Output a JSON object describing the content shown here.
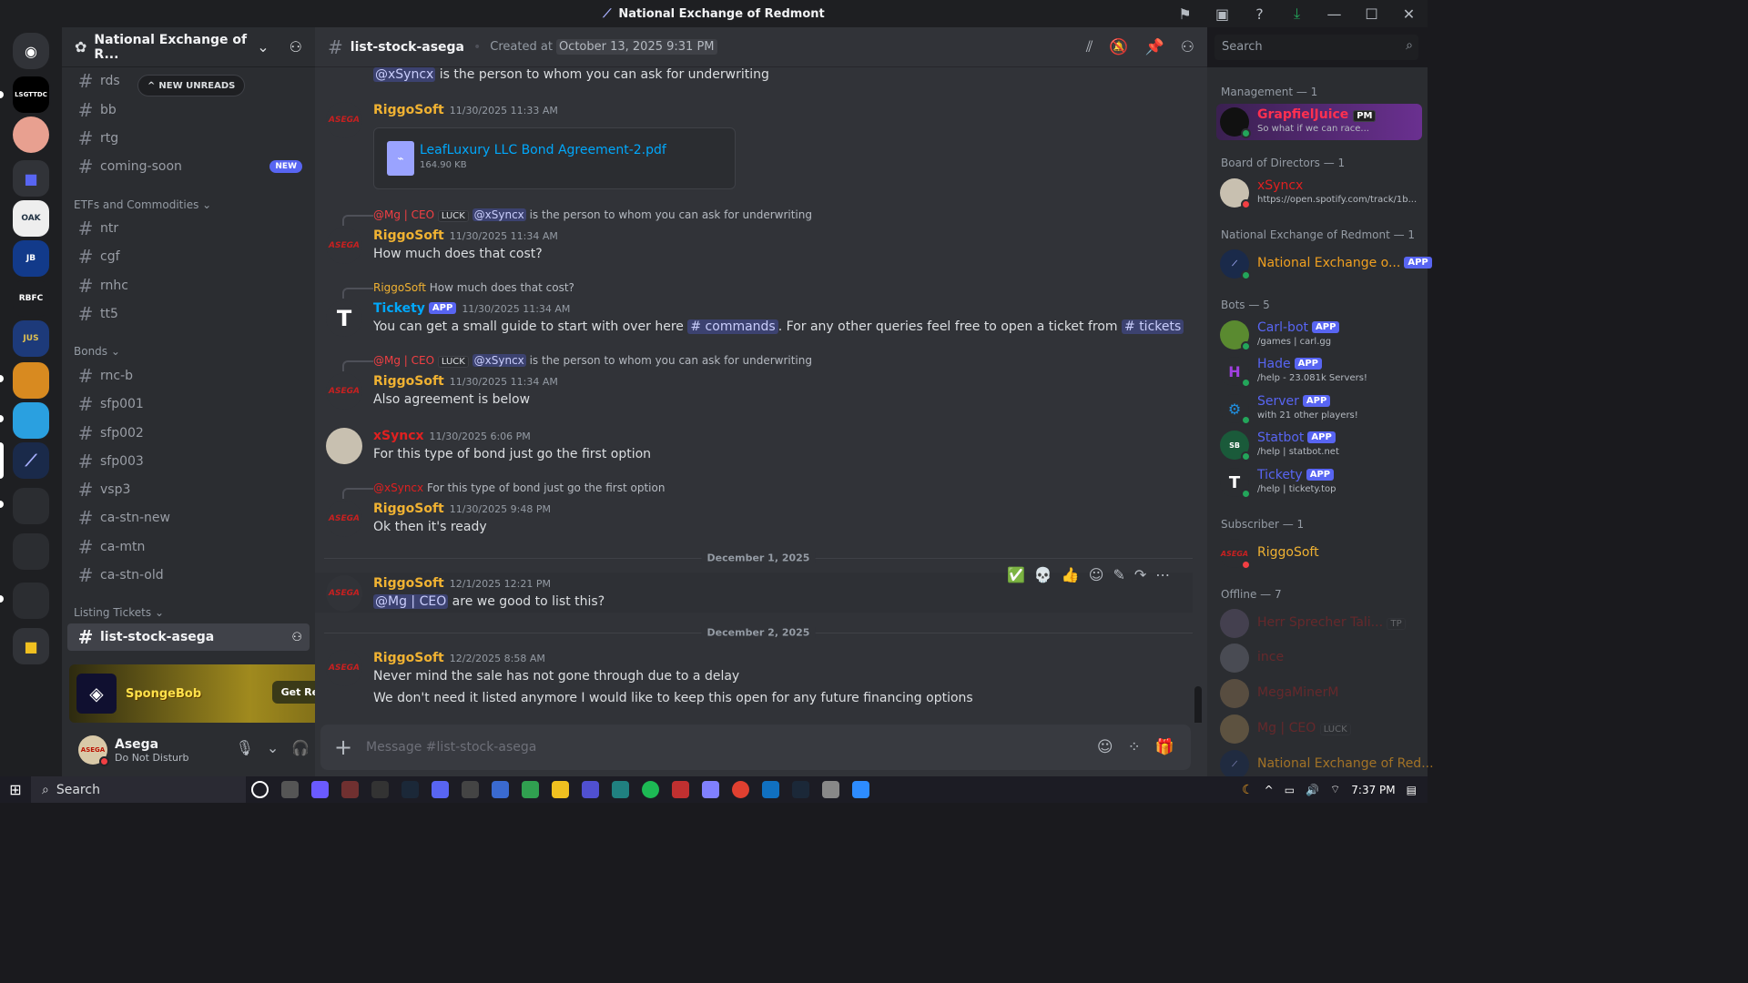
{
  "window": {
    "title": "National Exchange of Redmont"
  },
  "server": {
    "name": "National Exchange of R..."
  },
  "new_unreads": "NEW UNREADS",
  "channels": [
    {
      "name": "rds"
    },
    {
      "name": "bb"
    },
    {
      "name": "rtg"
    },
    {
      "name": "coming-soon",
      "badge": "NEW"
    }
  ],
  "cat_etfs": "ETFs and Commodities",
  "channels_etfs": [
    {
      "name": "ntr"
    },
    {
      "name": "cgf"
    },
    {
      "name": "rnhc"
    },
    {
      "name": "tt5"
    }
  ],
  "cat_bonds": "Bonds",
  "channels_bonds": [
    {
      "name": "rnc-b"
    },
    {
      "name": "sfp001"
    },
    {
      "name": "sfp002"
    },
    {
      "name": "sfp003"
    },
    {
      "name": "vsp3"
    },
    {
      "name": "ca-stn-new"
    },
    {
      "name": "ca-mtn"
    },
    {
      "name": "ca-stn-old"
    }
  ],
  "cat_listing": "Listing Tickets",
  "selected_channel": "list-stock-asega",
  "promo": {
    "logo": "SpongeBob",
    "button": "Get Reward!"
  },
  "user": {
    "name": "Asega",
    "status": "Do Not Disturb"
  },
  "header": {
    "channel": "list-stock-asega",
    "created_label": "Created at",
    "created_date": "October 13, 2025 9:31 PM"
  },
  "search": {
    "placeholder": "Search"
  },
  "messages": {
    "m0_mention": "@xSyncx",
    "m0_text": " is the person to whom you can ask for underwriting",
    "m1_user": "RiggoSoft",
    "m1_time": "11/30/2025 11:33 AM",
    "file_name": "LeafLuxury LLC Bond Agreement-2.pdf",
    "file_size": "164.90 KB",
    "r2_mg": "@Mg | CEO",
    "r2_luck": "LUCK",
    "r2_mention": "@xSyncx",
    "r2_text": " is the person to whom you can ask for underwriting",
    "m2_user": "RiggoSoft",
    "m2_time": "11/30/2025 11:34 AM",
    "m2_text": "How much does that cost?",
    "r3_user": "RiggoSoft",
    "r3_text": "How much does that cost?",
    "m3_user": "Tickety",
    "m3_app": "APP",
    "m3_time": "11/30/2025 11:34 AM",
    "m3_a": "You can get a small guide to start with over here ",
    "m3_ch1": "# commands",
    "m3_b": ". For any other queries feel free to open a ticket from ",
    "m3_ch2": "# tickets",
    "r4_mg": "@Mg | CEO",
    "r4_luck": "LUCK",
    "r4_mention": "@xSyncx",
    "r4_text": " is the person to whom you can ask for underwriting",
    "m4_user": "RiggoSoft",
    "m4_time": "11/30/2025 11:34 AM",
    "m4_text": "Also agreement is below",
    "m5_user": "xSyncx",
    "m5_time": "11/30/2025 6:06 PM",
    "m5_text": "For this type of bond just go the first option",
    "r6_user": "@xSyncx",
    "r6_text": "For this type of bond just go the first option",
    "m6_user": "RiggoSoft",
    "m6_time": "11/30/2025 9:48 PM",
    "m6_text": "Ok then it's ready",
    "sep1": "December 1, 2025",
    "m7_user": "RiggoSoft",
    "m7_time": "12/1/2025 12:21 PM",
    "m7_mention": "@Mg | CEO",
    "m7_text": " are we good to list this?",
    "sep2": "December 2, 2025",
    "m8_user": "RiggoSoft",
    "m8_time": "12/2/2025 8:58 AM",
    "m8_text": "Never mind the sale has not gone through due to a delay",
    "m8_text2": "We don't need it listed anymore I would like to keep this open for any future financing options"
  },
  "composer": {
    "placeholder": "Message #list-stock-asega"
  },
  "members": {
    "mgmt": "Management — 1",
    "mgmt_name": "GrapfielJuice",
    "mgmt_tag": "PM",
    "mgmt_status": "So what if we can race...",
    "board": "Board of Directors — 1",
    "board_name": "xSyncx",
    "board_status": "https://open.spotify.com/track/1b...",
    "ner": "National Exchange of Redmont — 1",
    "ner_name": "National Exchange o...",
    "ner_app": "APP",
    "bots": "Bots — 5",
    "bot1": "Carl-bot",
    "bot1_s": "/games | carl.gg",
    "bot2": "Hade",
    "bot2_s": "/help - 23.081k Servers!",
    "bot3": "Server",
    "bot3_s": "with 21 other players!",
    "bot4": "Statbot",
    "bot4_s": "/help | statbot.net",
    "bot5": "Tickety",
    "bot5_s": "/help | tickety.top",
    "app": "APP",
    "sub": "Subscriber — 1",
    "sub_name": "RiggoSoft",
    "offline": "Offline — 7",
    "off1": "Herr Sprecher Tali...",
    "off1_tag": "TP",
    "off2": "ince",
    "off3": "MegaMinerM",
    "off4": "Mg | CEO",
    "off4_tag": "LUCK",
    "off5": "National Exchange of Red..."
  },
  "taskbar": {
    "search": "Search",
    "time": "7:37 PM"
  }
}
